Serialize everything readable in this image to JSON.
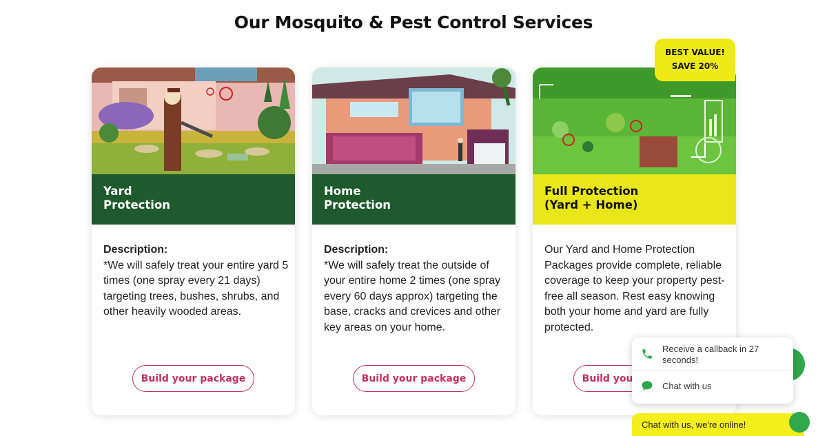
{
  "section": {
    "title": "Our Mosquito & Pest Control Services"
  },
  "cards": [
    {
      "title_line1": "Yard",
      "title_line2": "Protection",
      "description_label": "Description:",
      "description": "*We will safely treat your entire yard 5 times (one spray every 21 days) targeting trees, bushes, shrubs, and other heavily wooded areas.",
      "button_label": "Build your package",
      "image": "cartoon-exterminator-yard-illustration"
    },
    {
      "title_line1": "Home",
      "title_line2": "Protection",
      "description_label": "Description:",
      "description": "*We will safely treat the outside of your entire home 2 times (one spray every 60 days approx) targeting the base, cracks and crevices and other key areas on your home.",
      "button_label": "Build your package",
      "image": "modern-house-illustration"
    },
    {
      "title_line1": "Full Protection",
      "title_line2": "(Yard + Home)",
      "description": "Our Yard and Home Protection Packages provide complete, reliable coverage to keep your property pest-free all season. Rest easy knowing both your home and yard are fully protected.",
      "button_label": "Build your package",
      "badge_line1": "BEST VALUE!",
      "badge_line2": "SAVE 20%",
      "image": "green-yard-scan-illustration"
    }
  ],
  "chat_widget": {
    "callback_label": "Receive a callback in 27 seconds!",
    "chat_label": "Chat with us",
    "online_label": "Chat with us, we're online!",
    "callback_icon": "phone-icon",
    "chat_icon": "chat-bubble-icon"
  },
  "colors": {
    "dark_green": "#1f5a2c",
    "yellow": "#e8e619",
    "button_pink": "#c4305f",
    "widget_green": "#2ea84a"
  }
}
